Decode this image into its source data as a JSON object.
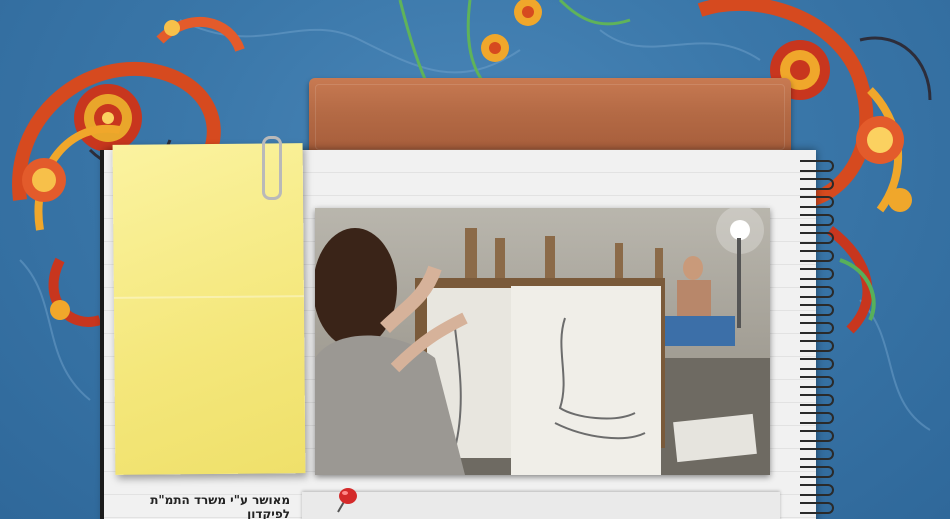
{
  "footer": {
    "approval_text": "מאושר  ע\"י משרד התמ\"ת לפיקדון"
  },
  "colors": {
    "background": "#3a77a9",
    "tape": "#b46a45",
    "sticky_note": "#f4e77b",
    "pin": "#d42a2a"
  },
  "icons": {
    "paperclip": "paperclip-icon",
    "pushpin": "pushpin-icon"
  },
  "photo": {
    "subject": "art-class-drawing-photo"
  }
}
